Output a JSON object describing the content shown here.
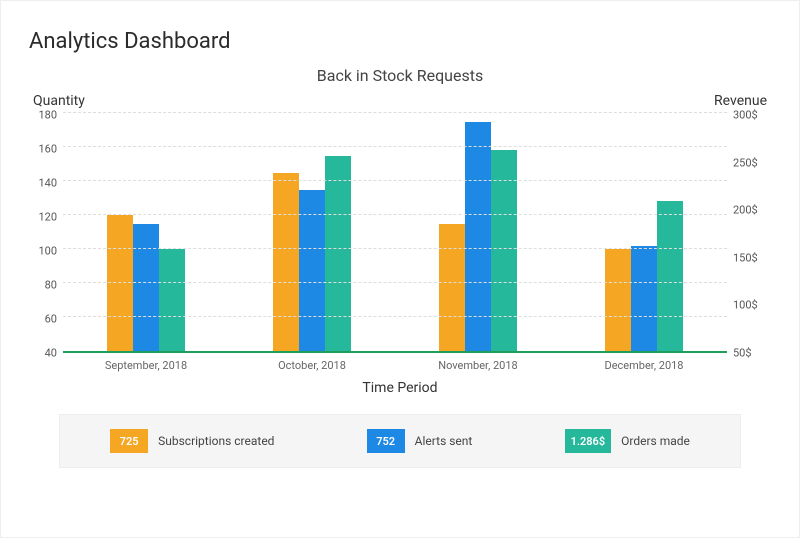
{
  "page_title": "Analytics Dashboard",
  "chart_data": {
    "type": "bar",
    "title": "Back in Stock Requests",
    "xlabel": "Time Period",
    "ylabel": "Quantity",
    "y2label": "Revenue",
    "categories": [
      "September, 2018",
      "October, 2018",
      "November, 2018",
      "December, 2018"
    ],
    "series": [
      {
        "name": "Subscriptions created",
        "color": "#f5a623",
        "values": [
          120,
          145,
          115,
          100
        ]
      },
      {
        "name": "Alerts sent",
        "color": "#1e88e5",
        "values": [
          115,
          135,
          175,
          102
        ]
      },
      {
        "name": "Orders made",
        "color": "#26b89a",
        "values": [
          100,
          155,
          158,
          128
        ]
      }
    ],
    "ylim": [
      40,
      180
    ],
    "y_ticks": [
      40,
      60,
      80,
      100,
      120,
      140,
      160,
      180
    ],
    "y2_ticks": [
      "50$",
      "100$",
      "150$",
      "200$",
      "250$",
      "300$"
    ]
  },
  "summary": {
    "subscriptions_value": "725",
    "subscriptions_label": "Subscriptions created",
    "alerts_value": "752",
    "alerts_label": "Alerts sent",
    "orders_value": "1.286$",
    "orders_label": "Orders made"
  }
}
